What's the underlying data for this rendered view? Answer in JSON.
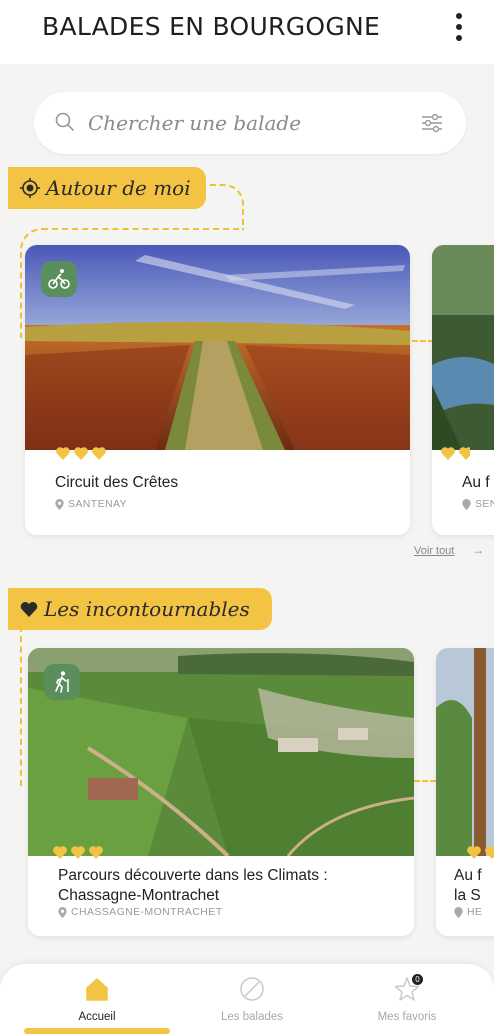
{
  "header": {
    "title": "BALADES EN BOURGOGNE",
    "menu_icon": "more-vertical-icon"
  },
  "search": {
    "placeholder": "Chercher une balade",
    "icon": "search-icon",
    "filter_icon": "filter-sliders-icon"
  },
  "sections": [
    {
      "label": "Autour de moi",
      "icon": "location-target-icon",
      "see_all": "Voir tout",
      "cards": [
        {
          "title": "Circuit des Crêtes",
          "location": "SANTENAY",
          "activity": "bike-icon",
          "hearts": 3
        },
        {
          "title": "Au f",
          "location": "SEN"
        }
      ]
    },
    {
      "label": "Les incontournables",
      "icon": "heart-icon",
      "cards": [
        {
          "title": "Parcours découverte dans les Climats : Chassagne-Montrachet",
          "location": "CHASSAGNE-MONTRACHET",
          "activity": "hiker-icon",
          "hearts": 3
        },
        {
          "title": "Au f la S",
          "location": "HE"
        }
      ]
    }
  ],
  "bottom_nav": [
    {
      "label": "Accueil",
      "icon": "home-icon",
      "active": true
    },
    {
      "label": "Les balades",
      "icon": "compass-icon",
      "active": false
    },
    {
      "label": "Mes favoris",
      "icon": "star-icon",
      "active": false,
      "badge": "0"
    }
  ],
  "colors": {
    "accent": "#f3c443",
    "badge_green": "#5a8f5c",
    "background": "#f4f4f2"
  }
}
